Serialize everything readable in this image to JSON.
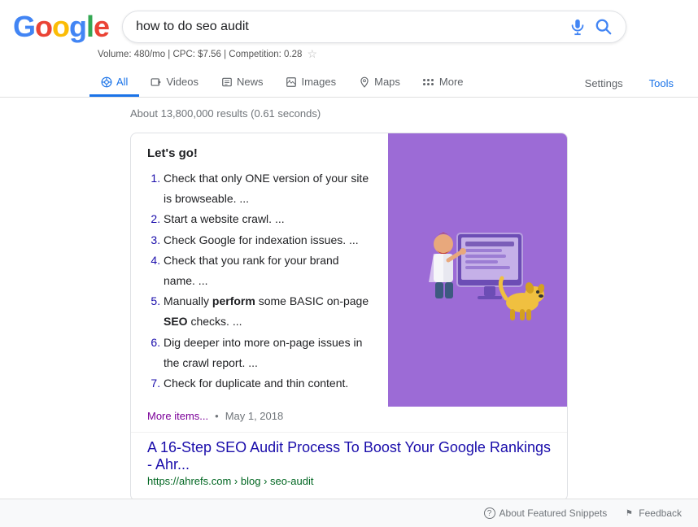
{
  "logo": {
    "letters": [
      "G",
      "o",
      "o",
      "g",
      "l",
      "e"
    ],
    "colors": [
      "#4285F4",
      "#EA4335",
      "#FBBC05",
      "#4285F4",
      "#34A853",
      "#EA4335"
    ]
  },
  "search": {
    "query": "how to do seo audit",
    "placeholder": "Search"
  },
  "volume_info": {
    "text": "Volume: 480/mo | CPC: $7.56 | Competition: 0.28"
  },
  "nav": {
    "tabs": [
      {
        "label": "All",
        "icon": "🔍",
        "active": true
      },
      {
        "label": "Videos",
        "icon": "▶",
        "active": false
      },
      {
        "label": "News",
        "icon": "📰",
        "active": false
      },
      {
        "label": "Images",
        "icon": "🖼",
        "active": false
      },
      {
        "label": "Maps",
        "icon": "📍",
        "active": false
      },
      {
        "label": "More",
        "icon": "⋮",
        "active": false
      }
    ],
    "right": [
      {
        "label": "Settings"
      },
      {
        "label": "Tools"
      }
    ]
  },
  "results_info": "About 13,800,000 results (0.61 seconds)",
  "featured_snippet": {
    "title": "Let's go!",
    "items": [
      "Check that only ONE version of your site is browseable. ...",
      "Start a website crawl. ...",
      "Check Google for indexation issues. ...",
      "Check that you rank for your brand name. ...",
      "Manually perform some BASIC on-page SEO checks. ...",
      "Dig deeper into more on-page issues in the crawl report. ...",
      "Check for duplicate and thin content."
    ],
    "items_bold": [
      {
        "index": 4,
        "word": "perform",
        "pre": "Manually ",
        "post": " some BASIC on-page "
      },
      {
        "index": 4,
        "word2": "SEO",
        "pre2": "Manually perform some BASIC on-page ",
        "post2": " checks. ..."
      }
    ],
    "more_items_label": "More items...",
    "date": "May 1, 2018",
    "result_title": "A 16-Step SEO Audit Process To Boost Your Google Rankings - Ahr...",
    "result_url": "https://ahrefs.com › blog › seo-audit"
  },
  "bottom": {
    "about_label": "About Featured Snippets",
    "feedback_label": "Feedback"
  }
}
